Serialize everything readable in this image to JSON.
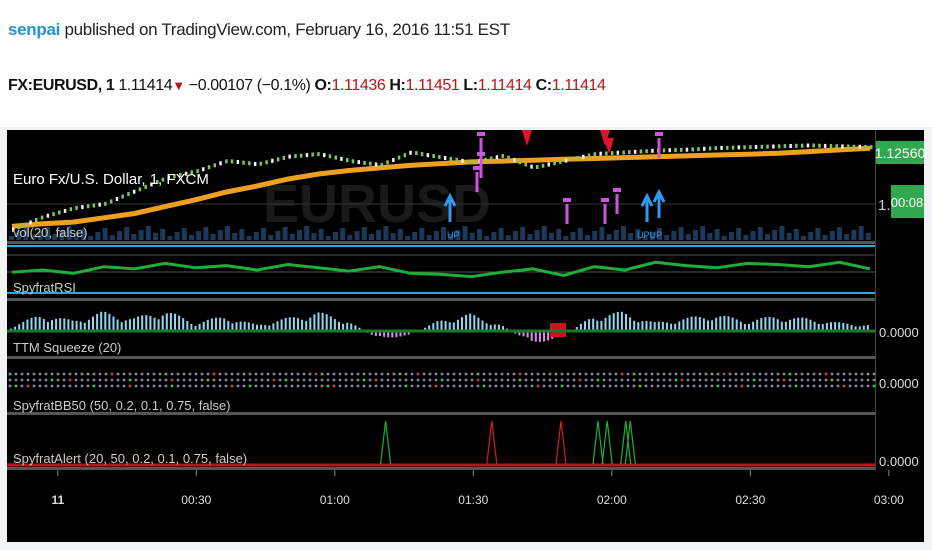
{
  "header": {
    "author": "senpai",
    "published_text": " published on TradingView.com, February 16, 2016 11:51 EST",
    "symbol": "FX:EURUSD, 1",
    "last": "1.11414",
    "change": "−0.00107 (−0.1%)",
    "o_label": "O:",
    "o": "1.11436",
    "h_label": "H:",
    "h": "1.11451",
    "l_label": "L:",
    "l": "1.11414",
    "c_label": "C:",
    "c": "1.11414"
  },
  "watermark": "EURUSD",
  "panes": {
    "price": {
      "title": "Euro Fx/U.S. Dollar, 1, FXCM",
      "sub": "vol(20, false)",
      "price_tag": "1.12560",
      "timer_tag": "00:08",
      "axis_partial": "1."
    },
    "rsi": {
      "title": "SpyfratRSI"
    },
    "ttm": {
      "title": "TTM Squeeze (20)",
      "value": "0.0000"
    },
    "bb": {
      "title": "SpyfratBB50 (50, 0.2, 0.1, 0.75, false)",
      "value": "0.0000"
    },
    "alert": {
      "title": "SpyfratAlert (20, 50, 0.2, 0.1, 0.75, false)",
      "value": "0.0000"
    }
  },
  "signals": {
    "up_label": "UP",
    "upup_label": "UPUP"
  },
  "colors": {
    "ema": "#f0a020",
    "rsi": "#1fae3a",
    "band": "#2aa8d8",
    "tag": "#2fa84f",
    "sell": "#e8102a",
    "pinkflag": "#cc55dd",
    "upflag": "#3399ee"
  },
  "chart_data": {
    "type": "line",
    "x_ticks": [
      "11",
      "00:30",
      "01:00",
      "01:30",
      "02:00",
      "02:30",
      "03:00"
    ],
    "xlim": [
      "00:00",
      "03:08"
    ],
    "series": [
      {
        "values": [
          1.1165,
          1.1168,
          1.117,
          1.1175,
          1.118,
          1.1188,
          1.1196,
          1.1205,
          1.1212,
          1.122,
          1.1226,
          1.123,
          1.1233,
          1.1236,
          1.1238,
          1.124,
          1.1241,
          1.1242,
          1.1243,
          1.1244,
          1.1245,
          1.1246,
          1.1247,
          1.1248,
          1.1249,
          1.125,
          1.1252,
          1.1254,
          1.1256
        ]
      },
      {
        "values": [
          1.116,
          1.1175,
          1.1185,
          1.119,
          1.1205,
          1.122,
          1.1228,
          1.124,
          1.1236,
          1.1245,
          1.1248,
          1.124,
          1.1235,
          1.125,
          1.1244,
          1.1238,
          1.1246,
          1.1232,
          1.124,
          1.1248,
          1.125,
          1.1252,
          1.1253,
          1.1255,
          1.1256,
          1.1257,
          1.1258,
          1.1257,
          1.1256
        ]
      },
      {
        "values": [
          58,
          60,
          57,
          63,
          61,
          66,
          62,
          64,
          60,
          65,
          62,
          59,
          63,
          57,
          56,
          54,
          58,
          61,
          55,
          63,
          60,
          67,
          64,
          62,
          66,
          65,
          63,
          67,
          61
        ]
      },
      {
        "values": [
          0.2,
          0.8,
          0.5,
          0.9,
          0.6,
          1.0,
          0.4,
          0.7,
          0.3,
          0.6,
          0.9,
          0.5,
          -0.4,
          -0.2,
          0.5,
          0.8,
          0.3,
          -0.6,
          -0.3,
          0.7,
          0.9,
          0.4,
          0.6,
          0.8,
          0.5,
          0.7,
          0.6,
          0.4,
          0.3
        ]
      }
    ],
    "alert_spikes": [
      "01:22",
      "01:45",
      "02:00",
      "02:08",
      "02:10",
      "02:14",
      "02:15"
    ]
  }
}
